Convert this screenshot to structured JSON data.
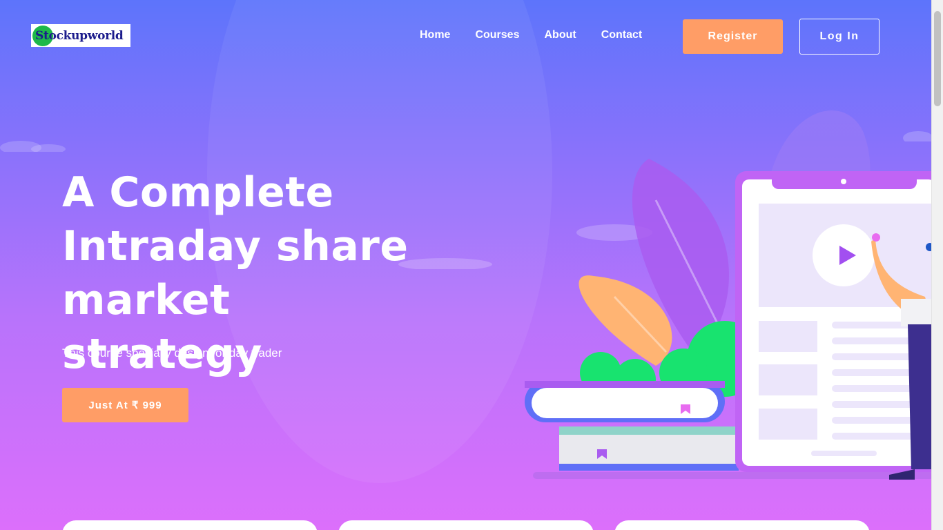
{
  "brand": {
    "name": "Stockupworld"
  },
  "nav": {
    "items": [
      {
        "label": "Home"
      },
      {
        "label": "Courses"
      },
      {
        "label": "About"
      },
      {
        "label": "Contact"
      }
    ]
  },
  "header": {
    "register_label": "Register",
    "login_label": "Log In"
  },
  "hero": {
    "title": "A Complete Intraday share market strategy",
    "subtitle": "This course specially design for day trader",
    "price_button": "Just At ₹ 999"
  },
  "colors": {
    "accent": "#ff9d66",
    "gradient_top": "#5d74fb",
    "gradient_bottom": "#dc6ffb",
    "leaf_green": "#18e36f"
  },
  "icons": [
    "play-icon",
    "bookmark-icon"
  ]
}
